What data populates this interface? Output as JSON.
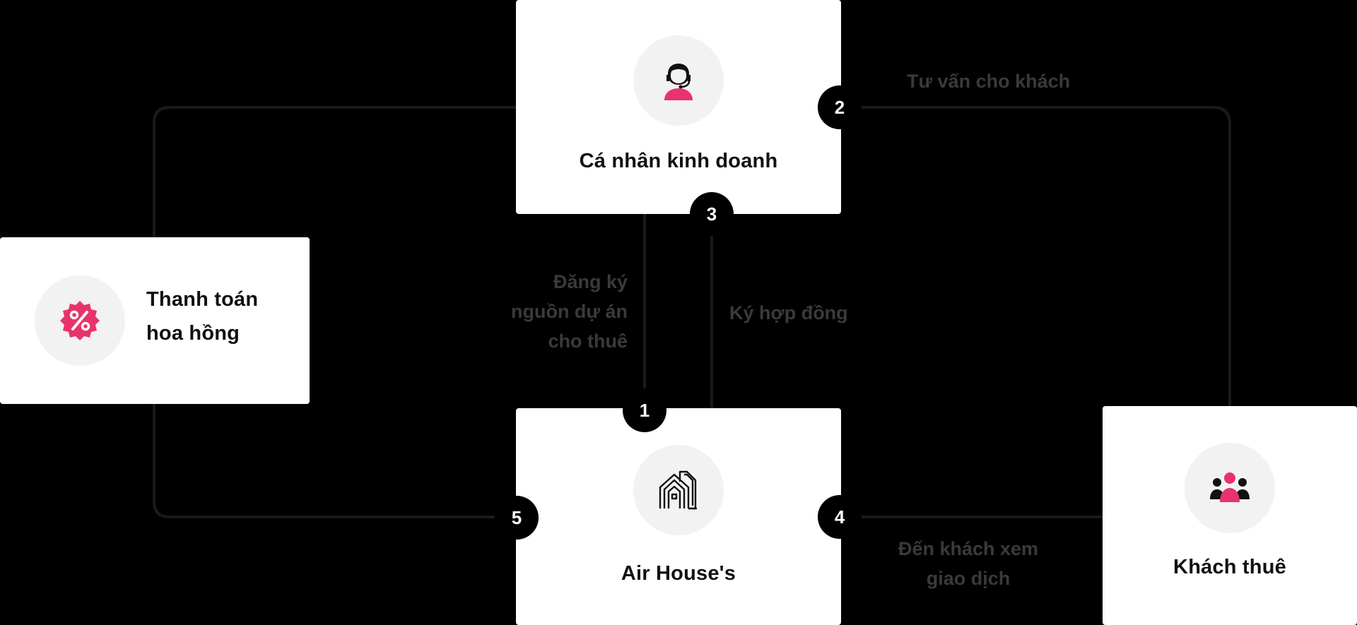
{
  "nodes": {
    "ca_nhan": {
      "title": "Cá nhân kinh doanh",
      "icon": "support-agent-icon"
    },
    "thanh_toan": {
      "line1": "Thanh toán",
      "line2": "hoa hồng",
      "icon": "percent-badge-icon"
    },
    "air_house": {
      "title": "Air House's",
      "icon": "house-building-icon"
    },
    "khach_thue": {
      "title": "Khách thuê",
      "icon": "people-group-icon"
    }
  },
  "steps": [
    "1",
    "2",
    "3",
    "4",
    "5"
  ],
  "labels": {
    "step2": "Tư vấn cho khách",
    "step1": [
      "Đăng ký",
      "nguồn dự án",
      "cho thuê"
    ],
    "step3": "Ký hợp đồng",
    "step4": [
      "Đến khách xem",
      "giao dịch"
    ]
  },
  "colors": {
    "accent": "#E8336D",
    "card": "#FFFFFF",
    "background": "#000000",
    "icon_bg": "#F2F2F2"
  }
}
